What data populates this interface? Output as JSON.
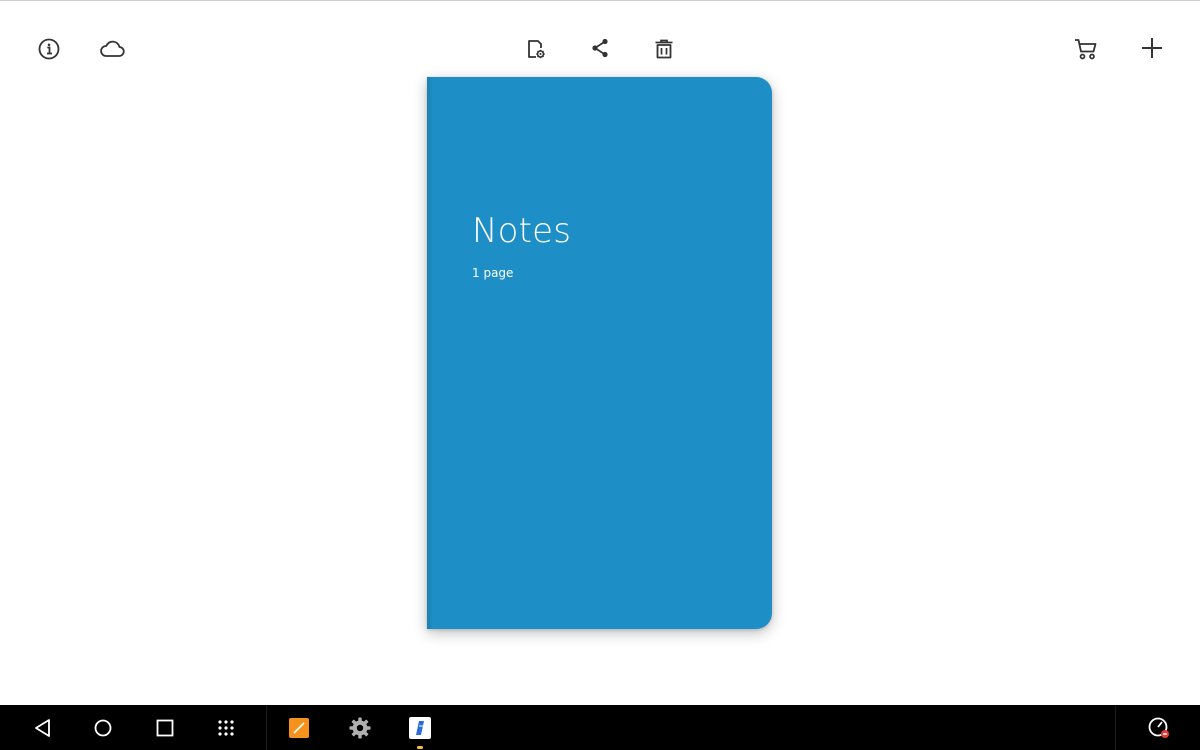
{
  "toolbar": {
    "left_icons": [
      "info-icon",
      "cloud-icon"
    ],
    "center_icons": [
      "page-settings-icon",
      "share-icon",
      "delete-icon"
    ],
    "right_icons": [
      "cart-icon",
      "add-icon"
    ]
  },
  "notebook": {
    "title": "Notes",
    "page_count_label": "1 page",
    "cover_color": "#1e8fc6"
  },
  "navbar": {
    "nav_icons": [
      "back-icon",
      "home-icon",
      "recents-icon",
      "app-drawer-icon"
    ],
    "apps": [
      {
        "name": "orange-drawing-app",
        "color": "#f5921e"
      },
      {
        "name": "settings-app",
        "color": "#9e9e9e"
      },
      {
        "name": "notebook-app",
        "color": "#2a6fd6",
        "running": true
      }
    ],
    "status_icon": "performance-mode-icon"
  }
}
